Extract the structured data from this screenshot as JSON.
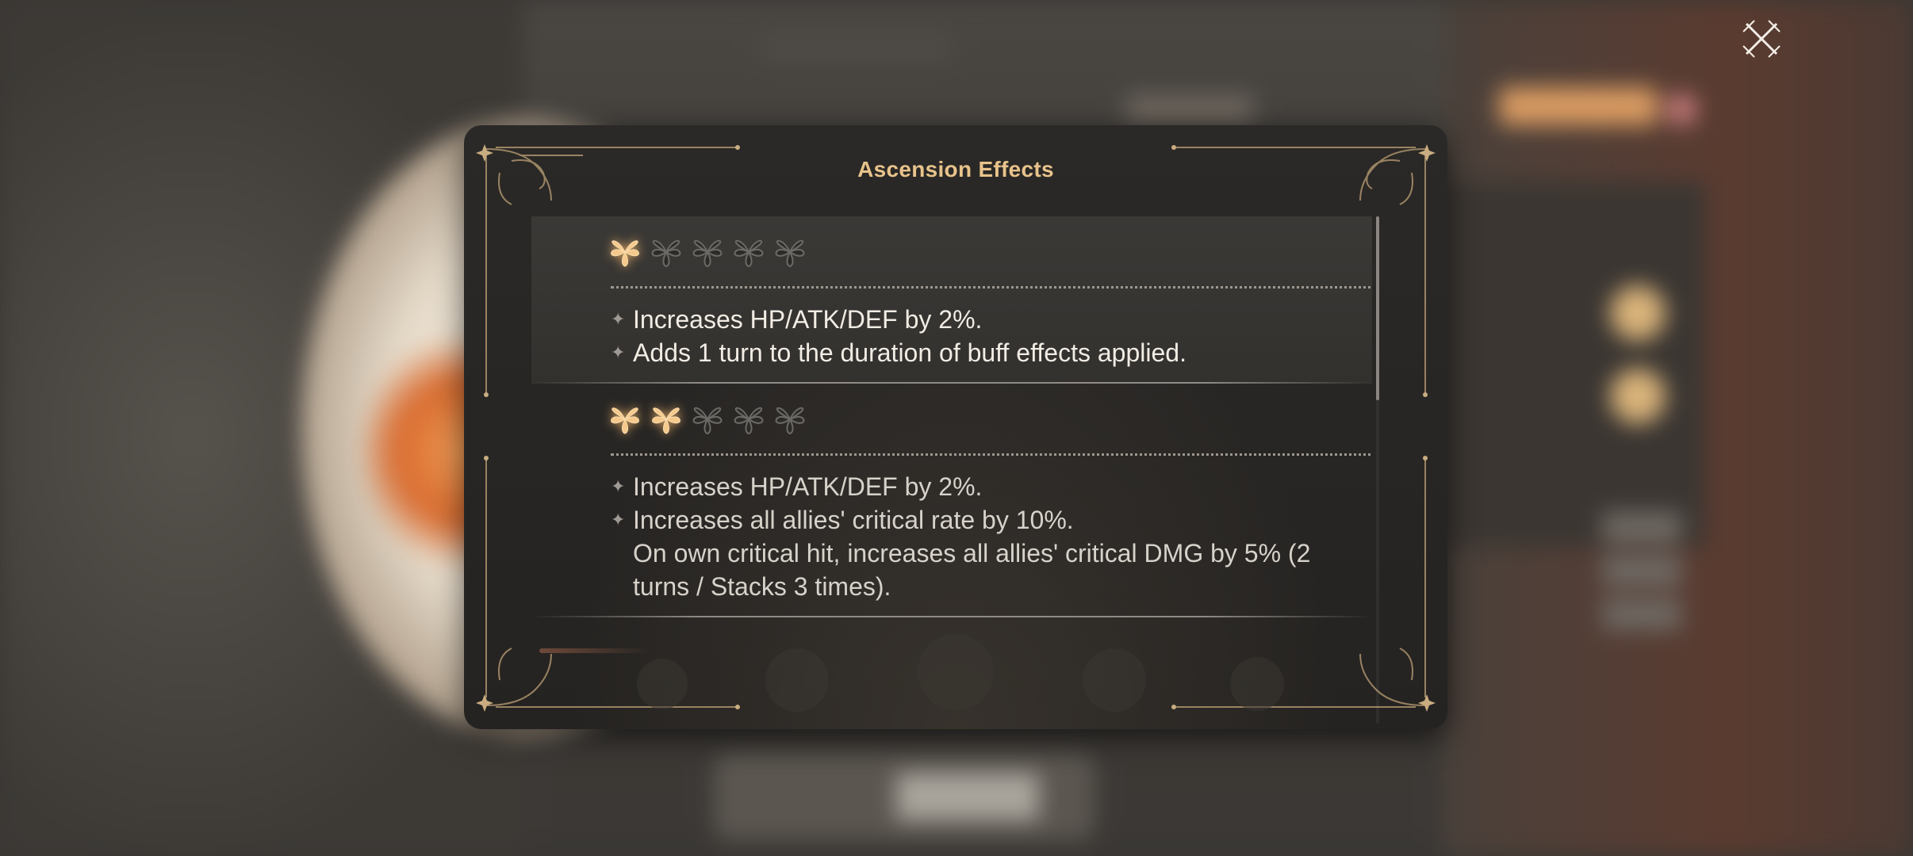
{
  "modal": {
    "title": "Ascension Effects"
  },
  "effects": [
    {
      "level": 1,
      "stars_filled": 1,
      "stars_total": 5,
      "lines": [
        "Increases HP/ATK/DEF by 2%.",
        "Adds 1 turn to the duration of buff effects applied."
      ]
    },
    {
      "level": 2,
      "stars_filled": 2,
      "stars_total": 5,
      "lines": [
        "Increases HP/ATK/DEF by 2%.",
        "Increases all allies' critical rate by 10%.",
        "On own critical hit, increases all allies' critical DMG by 5% (2 turns / Stacks 3 times)."
      ]
    }
  ],
  "colors": {
    "title": "#e8c38b",
    "star_filled": "#f6c98c",
    "star_empty": "#6c6a66",
    "text": "#f1ece4",
    "frame_gold": "#b59a72"
  },
  "icons": {
    "close": "close-x-icon",
    "star": "ascension-star-icon",
    "bullet": "sparkle-bullet-icon"
  }
}
